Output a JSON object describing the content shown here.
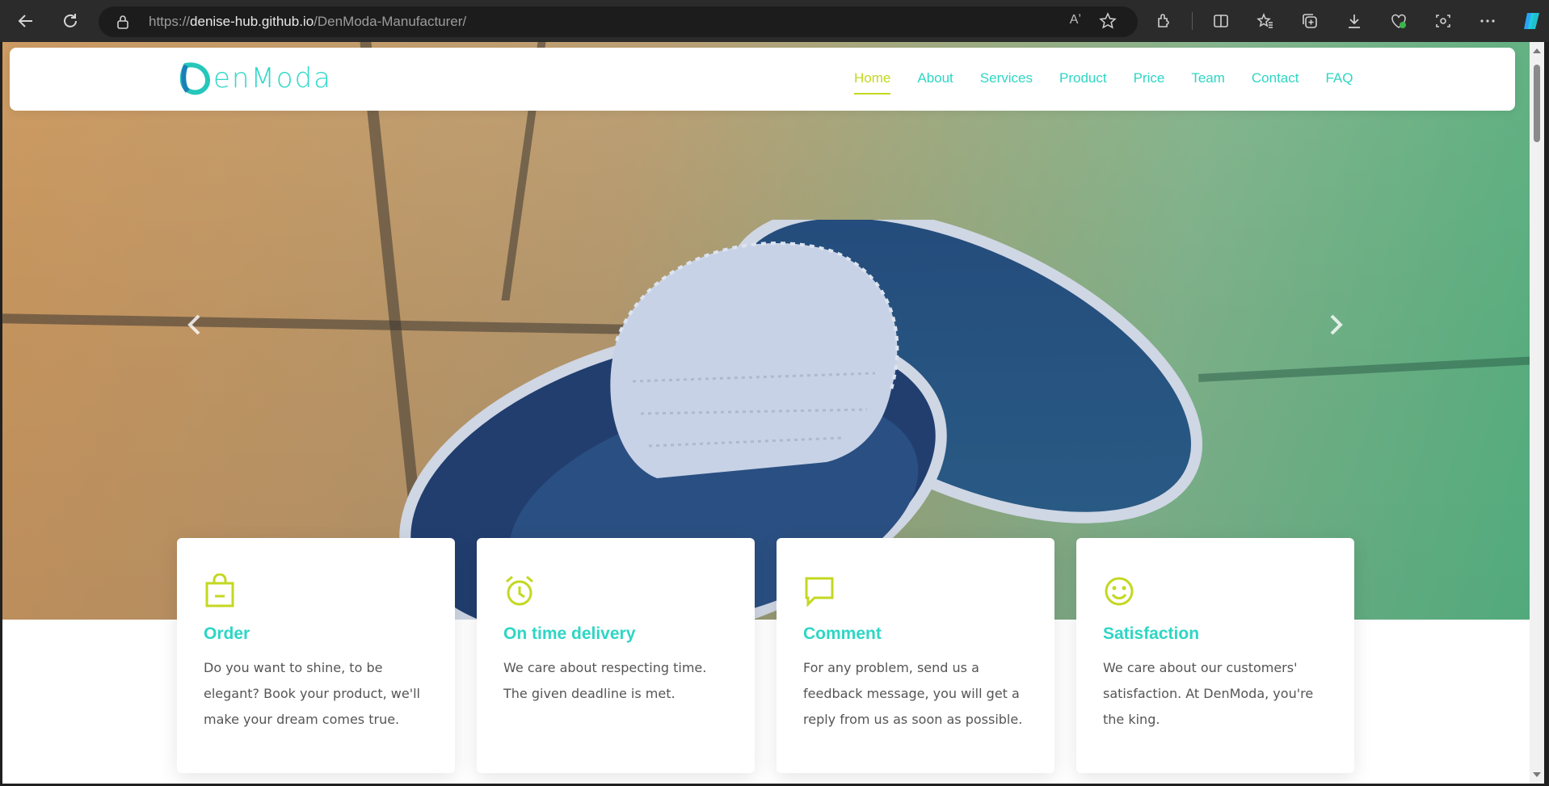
{
  "browser": {
    "url_scheme": "https://",
    "url_host": "denise-hub.github.io",
    "url_path": "/DenModa-Manufacturer/",
    "read_aloud": "Aʼ"
  },
  "site": {
    "logo_text": "enModa",
    "nav": [
      {
        "label": "Home",
        "active": true
      },
      {
        "label": "About"
      },
      {
        "label": "Services"
      },
      {
        "label": "Product"
      },
      {
        "label": "Price"
      },
      {
        "label": "Team"
      },
      {
        "label": "Contact"
      },
      {
        "label": "FAQ"
      }
    ]
  },
  "features": [
    {
      "icon": "shopping-bag-icon",
      "title": "Order",
      "text": "Do you want to shine, to be elegant? Book your product, we'll make your dream comes true."
    },
    {
      "icon": "alarm-clock-icon",
      "title": "On time delivery",
      "text": "We care about respecting time. The given deadline is met."
    },
    {
      "icon": "chat-bubble-icon",
      "title": "Comment",
      "text": "For any problem, send us a feedback message, you will get a reply from us as soon as possible."
    },
    {
      "icon": "smiley-icon",
      "title": "Satisfaction",
      "text": "We care about our customers' satisfaction. At DenModa, you're the king."
    }
  ],
  "colors": {
    "accent_teal": "#2ed6c4",
    "accent_lime": "#c3d820"
  }
}
